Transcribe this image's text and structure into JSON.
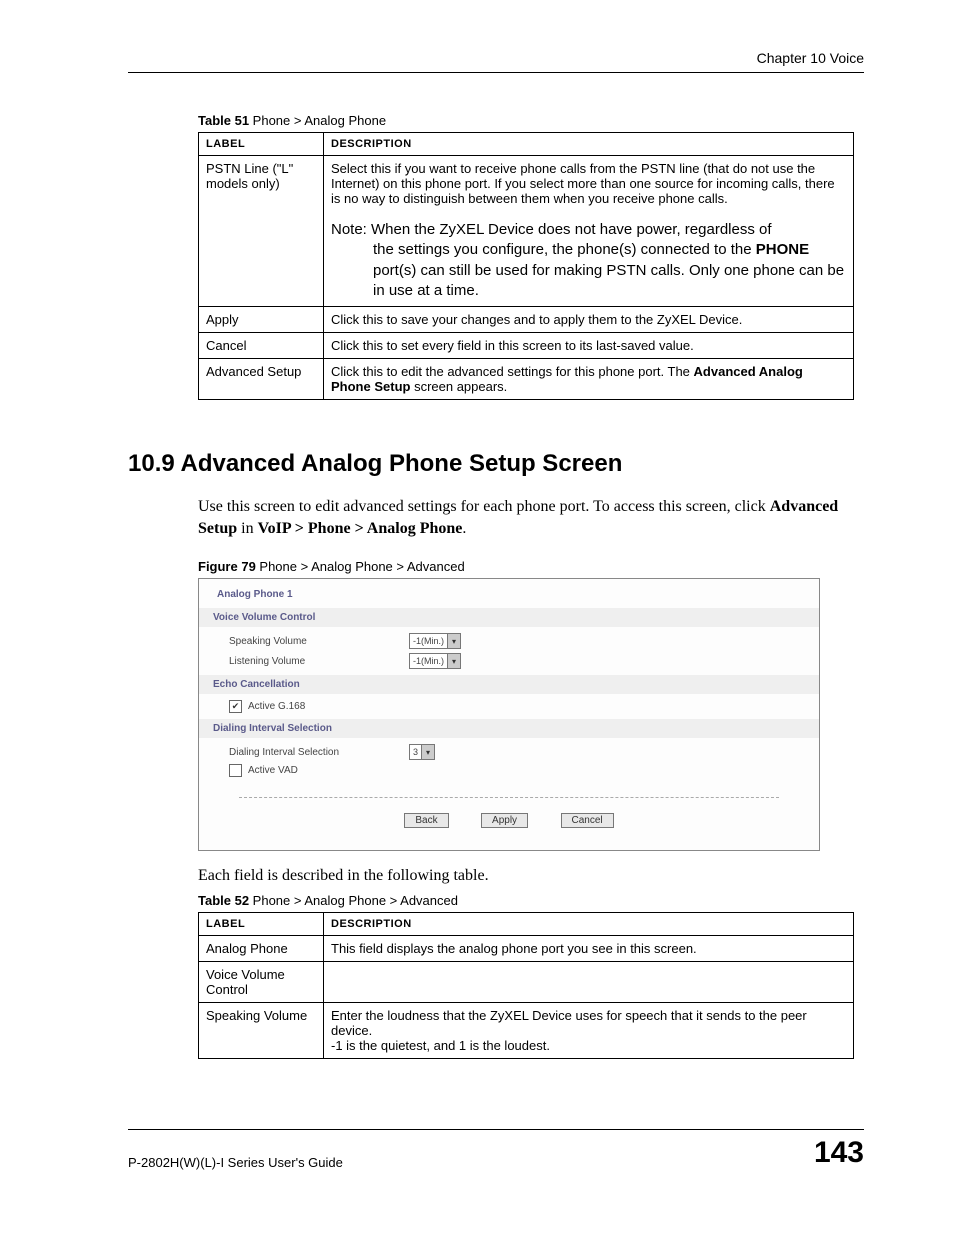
{
  "header": {
    "chapter": "Chapter 10 Voice"
  },
  "table51": {
    "caption_bold": "Table 51",
    "caption_rest": "   Phone > Analog Phone",
    "head_label": "Label",
    "head_desc": "Description",
    "rows": [
      {
        "label": "PSTN Line (\"L\" models only)",
        "desc_main": "Select this if you want to receive phone calls from the PSTN line (that do not use the Internet) on this phone port. If you select more than one source for incoming calls, there is no way to distinguish between them when you receive phone calls.",
        "note_lead": "Note: When the ZyXEL Device does not have power, regardless of",
        "note_rest1": "the settings you configure, the phone(s) connected to the ",
        "note_bold": "PHONE",
        "note_rest2": " port(s) can still be used for making PSTN calls. Only one phone can be in use at a time."
      },
      {
        "label": "Apply",
        "desc": "Click this to save your changes and to apply them to the ZyXEL Device."
      },
      {
        "label": "Cancel",
        "desc": "Click this to set every field in this screen to its last-saved value."
      },
      {
        "label": "Advanced Setup",
        "desc_pre": "Click this to edit the advanced settings for this phone port. The ",
        "desc_bold": "Advanced Analog Phone Setup",
        "desc_post": " screen appears."
      }
    ]
  },
  "section": {
    "heading": "10.9  Advanced Analog Phone Setup Screen",
    "intro_pre": "Use this screen to edit advanced settings for each phone port. To access this screen, click ",
    "intro_b1": "Advanced Setup",
    "intro_mid": " in ",
    "intro_b2": "VoIP > Phone > Analog Phone",
    "intro_post": "."
  },
  "figure79": {
    "caption_bold": "Figure 79",
    "caption_rest": "   Phone > Analog Phone > Advanced",
    "title": "Analog Phone 1",
    "sec1": "Voice Volume Control",
    "speaking_label": "Speaking Volume",
    "listening_label": "Listening Volume",
    "select_val": "-1(Min.)",
    "sec2": "Echo Cancellation",
    "g168_label": "Active G.168",
    "g168_checked": "✔",
    "sec3": "Dialing Interval Selection",
    "dial_label": "Dialing Interval Selection",
    "dial_val": "3",
    "vad_label": "Active VAD",
    "btn_back": "Back",
    "btn_apply": "Apply",
    "btn_cancel": "Cancel"
  },
  "body2": "Each field is described in the following table.",
  "table52": {
    "caption_bold": "Table 52",
    "caption_rest": "   Phone > Analog Phone > Advanced",
    "head_label": "Label",
    "head_desc": "Description",
    "rows": [
      {
        "label": "Analog Phone",
        "desc": "This field displays the analog phone port you see in this screen."
      },
      {
        "label": "Voice Volume Control",
        "desc": ""
      },
      {
        "label": "Speaking Volume",
        "desc": "Enter the loudness that the ZyXEL Device uses for speech that it sends to the peer device.\n-1 is the quietest, and 1 is the loudest."
      }
    ]
  },
  "footer": {
    "left": "P-2802H(W)(L)-I Series User's Guide",
    "right": "143"
  }
}
